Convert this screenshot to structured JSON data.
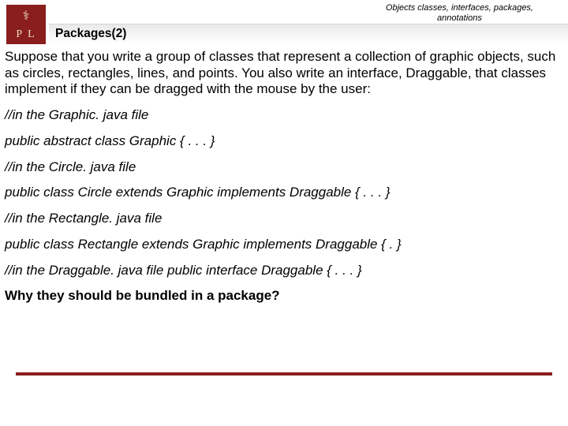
{
  "header": {
    "breadcrumb_line1": "Objects classes, interfaces, packages,",
    "breadcrumb_line2": "annotations",
    "title": "Packages(2)",
    "logo_letters": "P   L",
    "logo_top": "⚕"
  },
  "body": {
    "intro": "Suppose that you write a group of classes that represent a collection of graphic objects, such as circles, rectangles, lines, and points. You also write an interface, Draggable, that classes implement if they can be dragged with the mouse by the user:",
    "c1": "//in the Graphic. java file",
    "c2": "public abstract class Graphic { . . . }",
    "c3": "//in the Circle. java file",
    "c4": "public class Circle extends Graphic implements Draggable { . . . }",
    "c5": "//in the Rectangle. java file",
    "c6": "public class Rectangle extends Graphic implements Draggable { . }",
    "c7": "//in the Draggable. java file public interface Draggable { . . . }",
    "q": "Why they should be bundled in a package?"
  }
}
